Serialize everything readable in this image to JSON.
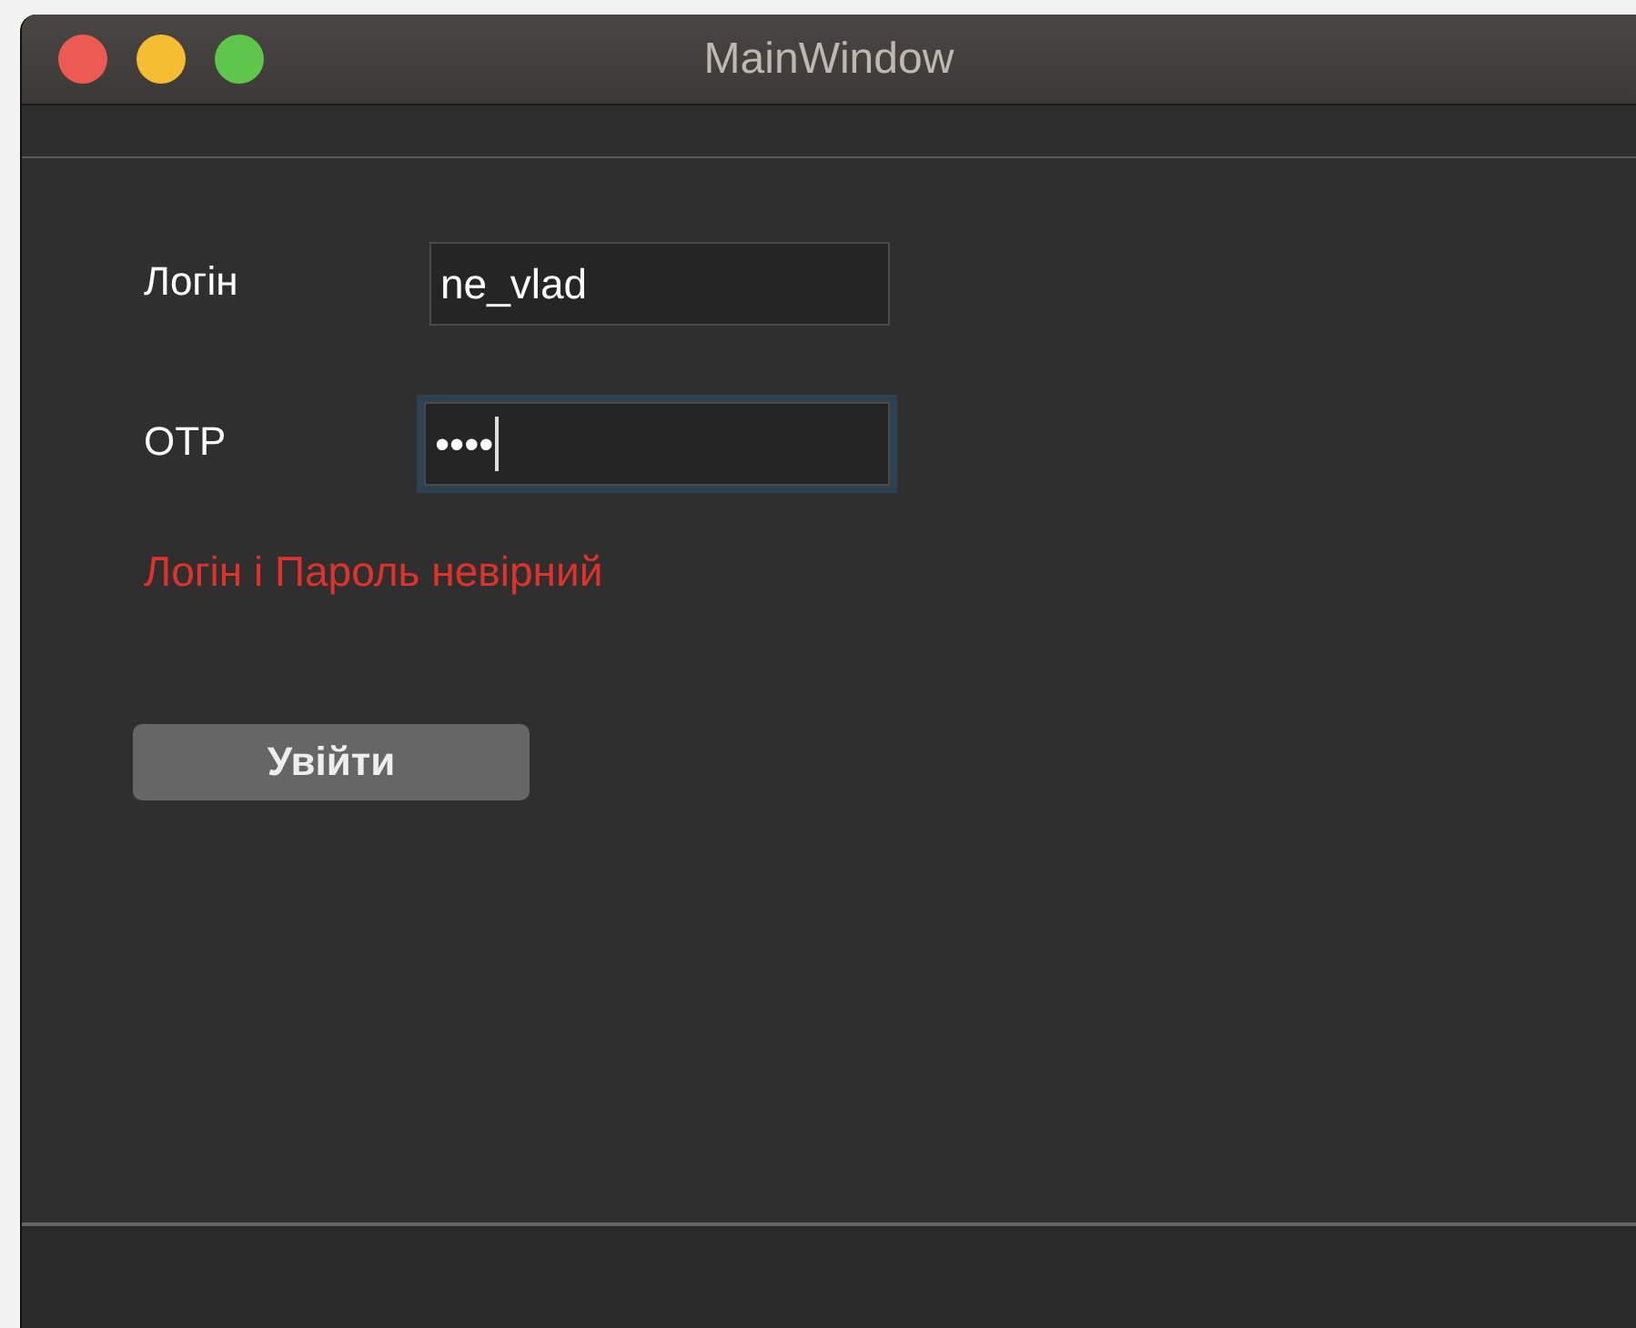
{
  "window": {
    "title": "MainWindow",
    "controls": [
      {
        "color": "#ec5a53"
      },
      {
        "color": "#f5bd31"
      },
      {
        "color": "#5ec64a"
      }
    ]
  },
  "form": {
    "fields": [
      {
        "label": "Логін",
        "value": "ne_vlad",
        "focused": false
      },
      {
        "label": "OTP",
        "value": "••••",
        "focused": true
      }
    ],
    "error": "Логін і Пароль невірний",
    "button": "Увійти"
  }
}
